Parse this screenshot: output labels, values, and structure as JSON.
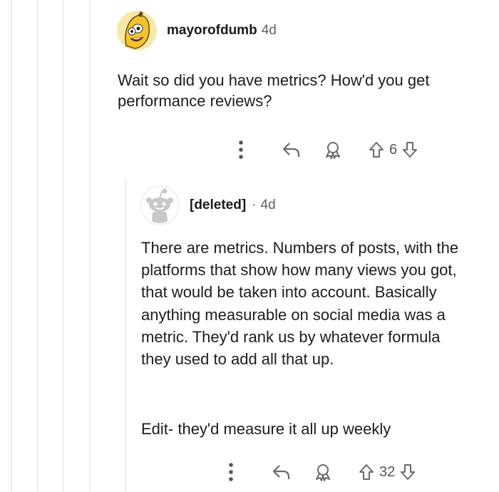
{
  "colors": {
    "thread_line": "#e2e2e2",
    "icon": "#6a6a6a",
    "text": "#1c1c1c",
    "meta": "#5f6368"
  },
  "comments": [
    {
      "author": "mayorofdumb",
      "age": "4d",
      "avatar_icon": "banana-avatar-icon",
      "text": "Wait so did you have metrics? How'd you get performance reviews?",
      "score": "6"
    },
    {
      "author": "[deleted]",
      "separator": "·",
      "age": "4d",
      "avatar_icon": "snoo-avatar-icon",
      "paragraphs": [
        "There are metrics. Numbers of posts, with the platforms that show how many views you got, that would be taken into account. Basically anything measurable on social media was a metric. They'd rank us by whatever formula they used to add all that up.",
        "Edit- they'd measure it all up weekly"
      ],
      "score": "32"
    }
  ]
}
